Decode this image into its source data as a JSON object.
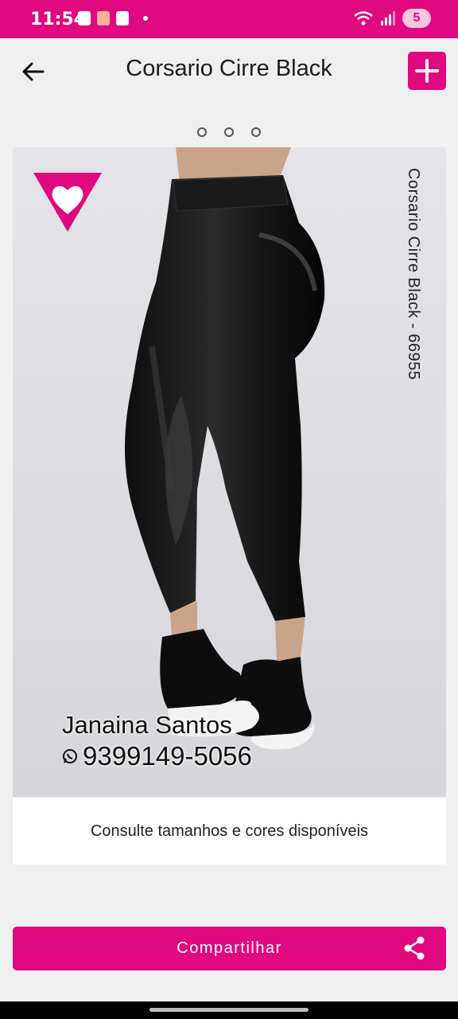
{
  "status_bar": {
    "time": "11:54",
    "notification_count": "5",
    "icons": [
      "alert-icon",
      "app-icon",
      "face-icon",
      "wifi-icon",
      "signal-icon"
    ]
  },
  "header": {
    "title": "Corsario Cirre Black",
    "back_icon": "arrow-left-icon",
    "add_icon": "plus-icon"
  },
  "carousel": {
    "page_count": 3
  },
  "product": {
    "side_caption": "Corsario Cirre Black - 66955",
    "seller_name": "Janaina Santos",
    "seller_phone": "9399149-5056",
    "info_text": "Consulte tamanhos e cores disponíveis"
  },
  "share": {
    "label": "Compartilhar",
    "icon": "share-icon"
  },
  "colors": {
    "accent": "#e0097f",
    "background": "#efefef"
  }
}
